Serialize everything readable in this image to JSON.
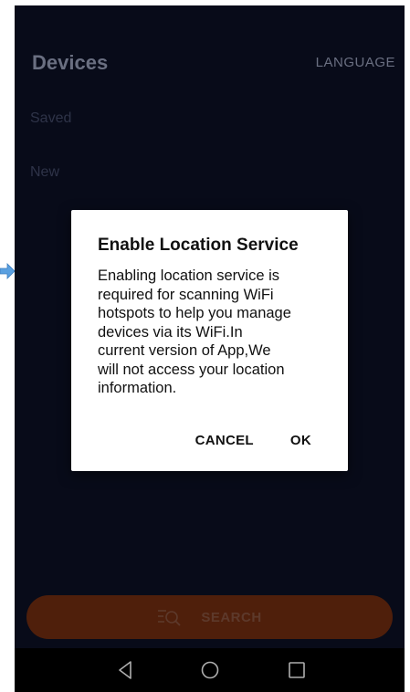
{
  "screen": {
    "title": "Devices",
    "language_label": "LANGUAGE",
    "sections": {
      "saved": "Saved",
      "new": "New"
    },
    "search_label": "SEARCH"
  },
  "dialog": {
    "title": "Enable Location Service",
    "message": "Enabling location service is\nrequired for scanning WiFi\nhotspots to help you manage\ndevices via its WiFi.In\ncurrent version of App,We\nwill not access your location\ninformation.",
    "cancel_label": "CANCEL",
    "ok_label": "OK"
  },
  "icons": {
    "search": "search-list-icon",
    "back": "back-triangle-icon",
    "home": "home-circle-icon",
    "recent": "recent-square-icon",
    "arrow": "arrow-right-icon"
  },
  "colors": {
    "background": "#0b0f22",
    "search_bar": "#6a2a0f",
    "arrow": "#5aa0e0"
  }
}
